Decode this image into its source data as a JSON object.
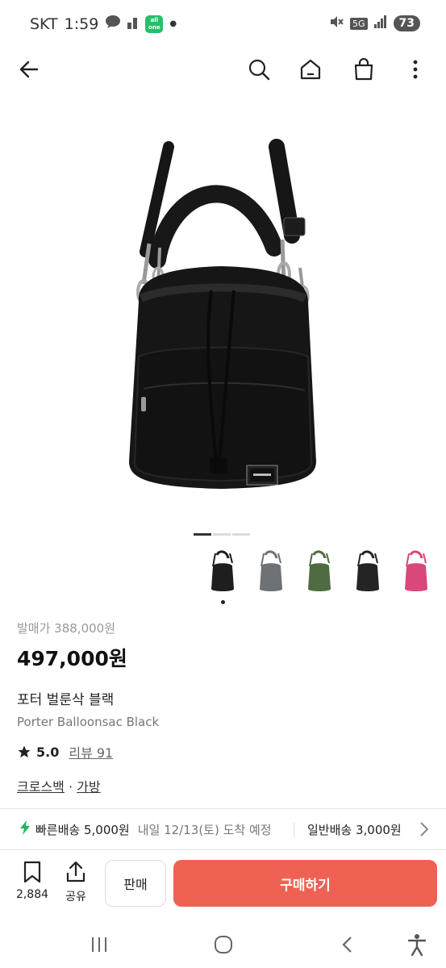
{
  "status_bar": {
    "carrier": "SKT",
    "time": "1:59",
    "battery": "73",
    "network": "5G",
    "app_badge": "all one"
  },
  "nav": {
    "icons": [
      "back-arrow-icon",
      "search-icon",
      "home-icon",
      "shopping-bag-icon",
      "more-vertical-icon"
    ]
  },
  "gallery": {
    "page_count": 3,
    "current_page": 1,
    "thumbnails": [
      {
        "color_name": "black",
        "color": "#1e1e1e",
        "selected": true
      },
      {
        "color_name": "gray",
        "color": "#6e7175",
        "selected": false
      },
      {
        "color_name": "olive",
        "color": "#4f6b42",
        "selected": false
      },
      {
        "color_name": "black-quilted",
        "color": "#242424",
        "selected": false
      },
      {
        "color_name": "pink",
        "color": "#d9487a",
        "selected": false
      }
    ]
  },
  "product": {
    "original_price": "발매가 388,000원",
    "price": "497,000원",
    "name_ko": "포터 벌룬삭 블랙",
    "name_en": "Porter Balloonsac Black",
    "rating": "5.0",
    "reviews": "리뷰 91",
    "category_1": "크로스백",
    "category_sep": " · ",
    "category_2": "가방"
  },
  "shipping": {
    "fast_label": "빠른배송 5,000원",
    "fast_eta": "내일 12/13(토) 도착 예정",
    "normal_label": "일반배송 3,000원"
  },
  "actions": {
    "bookmark_count": "2,884",
    "share_label": "공유",
    "sell_label": "판매",
    "buy_label": "구매하기"
  },
  "colors": {
    "accent": "#ef6253",
    "fast_shipping": "#22b35a"
  }
}
